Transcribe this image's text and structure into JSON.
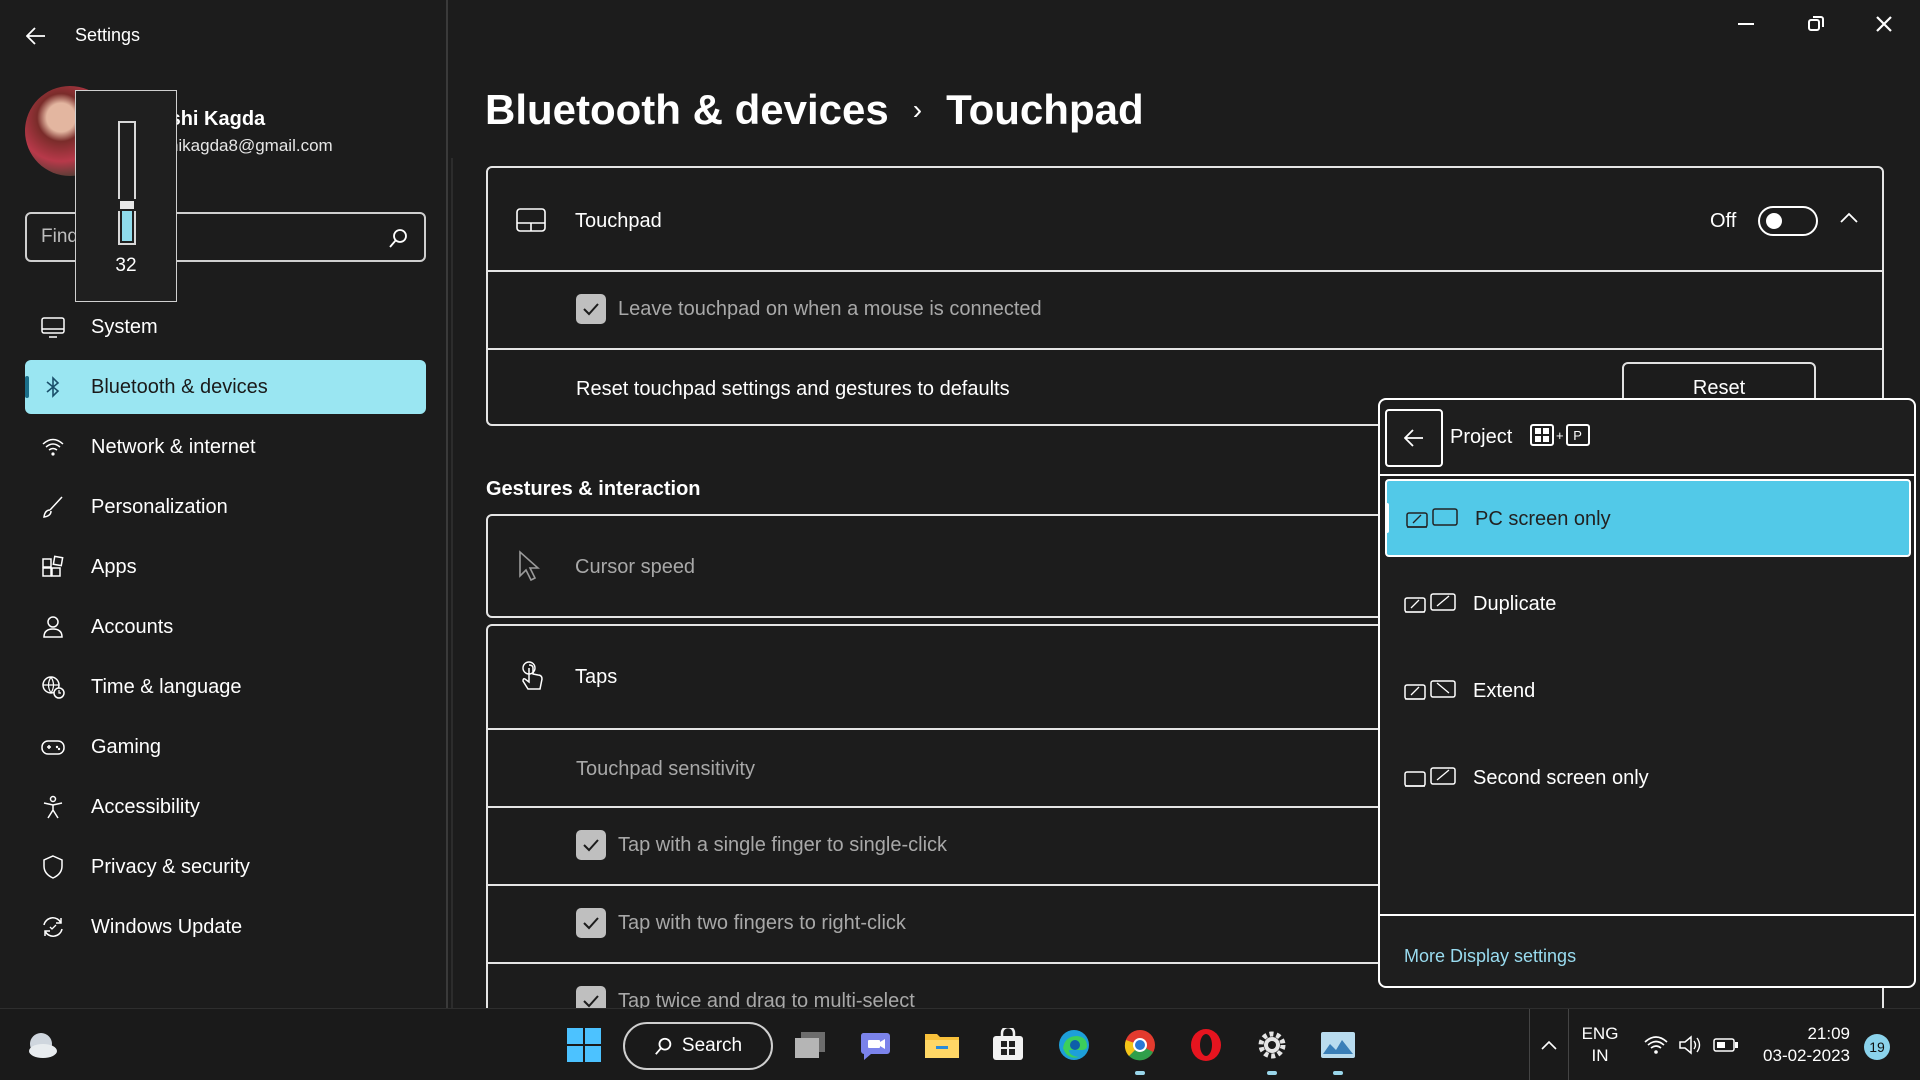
{
  "window": {
    "title": "Settings"
  },
  "user": {
    "name": "Sakshi Kagda",
    "email": "sakshikagda8@gmail.com"
  },
  "search": {
    "placeholder": "Find a setting"
  },
  "osd": {
    "value": "32",
    "level": 0.32
  },
  "sidebar": {
    "items": [
      {
        "label": "System",
        "icon": "monitor-icon",
        "active": false
      },
      {
        "label": "Bluetooth & devices",
        "icon": "bluetooth-icon",
        "active": true
      },
      {
        "label": "Network & internet",
        "icon": "wifi-icon",
        "active": false
      },
      {
        "label": "Personalization",
        "icon": "brush-icon",
        "active": false
      },
      {
        "label": "Apps",
        "icon": "apps-icon",
        "active": false
      },
      {
        "label": "Accounts",
        "icon": "person-icon",
        "active": false
      },
      {
        "label": "Time & language",
        "icon": "globe-clock-icon",
        "active": false
      },
      {
        "label": "Gaming",
        "icon": "gamepad-icon",
        "active": false
      },
      {
        "label": "Accessibility",
        "icon": "accessibility-icon",
        "active": false
      },
      {
        "label": "Privacy & security",
        "icon": "shield-icon",
        "active": false
      },
      {
        "label": "Windows Update",
        "icon": "update-icon",
        "active": false
      }
    ]
  },
  "breadcrumb": {
    "parent": "Bluetooth & devices",
    "separator": "›",
    "current": "Touchpad"
  },
  "touchpad": {
    "title": "Touchpad",
    "state_label": "Off",
    "enabled": false,
    "leave_on_label": "Leave touchpad on when a mouse is connected",
    "leave_on_checked": true,
    "reset_label": "Reset touchpad settings and gestures to defaults",
    "reset_button": "Reset"
  },
  "gestures": {
    "section_title": "Gestures & interaction",
    "cursor_speed": "Cursor speed",
    "taps_title": "Taps",
    "sensitivity": "Touchpad sensitivity",
    "options": [
      {
        "label": "Tap with a single finger to single-click",
        "checked": true
      },
      {
        "label": "Tap with two fingers to right-click",
        "checked": true
      },
      {
        "label": "Tap twice and drag to multi-select",
        "checked": true
      }
    ]
  },
  "project": {
    "title": "Project",
    "shortcut_key": "P",
    "options": [
      {
        "label": "PC screen only",
        "icon": "pc-screen-only-icon",
        "selected": true
      },
      {
        "label": "Duplicate",
        "icon": "duplicate-icon",
        "selected": false
      },
      {
        "label": "Extend",
        "icon": "extend-icon",
        "selected": false
      },
      {
        "label": "Second screen only",
        "icon": "second-screen-only-icon",
        "selected": false
      }
    ],
    "more_link": "More Display settings"
  },
  "taskbar": {
    "search_label": "Search",
    "language_line1": "ENG",
    "language_line2": "IN",
    "time": "21:09",
    "date": "03-02-2023",
    "notifications": "19"
  },
  "colors": {
    "background": "#1c1c1c",
    "accent": "#9ae6f2",
    "selected_option": "#52c9e8",
    "link": "#99dcf0"
  }
}
